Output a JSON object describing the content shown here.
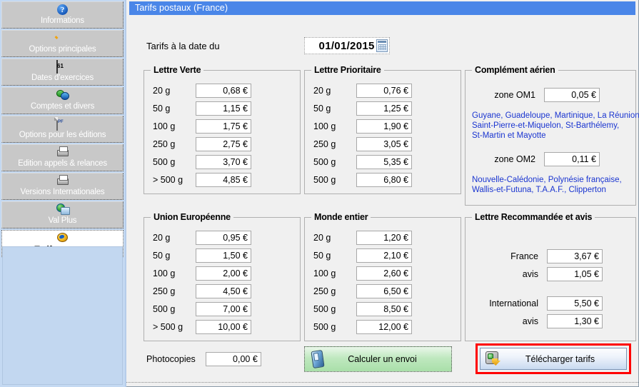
{
  "sidebar": {
    "items": [
      {
        "label": "Informations",
        "icon": "help-icon",
        "active": false
      },
      {
        "label": "Options principales",
        "icon": "gear-icon",
        "active": false
      },
      {
        "label": "Dates d'exercices",
        "icon": "calendar-icon",
        "active": false
      },
      {
        "label": "Comptes et divers",
        "icon": "coins-icon",
        "active": false
      },
      {
        "label": "Options pour les éditions",
        "icon": "pdf-document-icon",
        "active": false
      },
      {
        "label": "Edition appels & relances",
        "icon": "printer-icon",
        "active": false
      },
      {
        "label": "Versions Internationales",
        "icon": "printer-icon",
        "active": false
      },
      {
        "label": "Val Plus",
        "icon": "globe-monitor-icon",
        "active": false
      },
      {
        "label": "Tarifs postaux",
        "icon": "stamp-icon",
        "active": true
      }
    ]
  },
  "titlebar": {
    "title": "Tarifs postaux (France)"
  },
  "date_row": {
    "label": "Tarifs à la date du",
    "value": "01/01/2015",
    "calendar_icon": "calendar-picker-icon"
  },
  "groups": {
    "lettre_verte": {
      "title": "Lettre Verte",
      "rows": [
        {
          "weight": "20 g",
          "price": "0,68 €"
        },
        {
          "weight": "50 g",
          "price": "1,15 €"
        },
        {
          "weight": "100 g",
          "price": "1,75 €"
        },
        {
          "weight": "250 g",
          "price": "2,75 €"
        },
        {
          "weight": "500 g",
          "price": "3,70 €"
        },
        {
          "weight": "> 500 g",
          "price": "4,85 €"
        }
      ]
    },
    "lettre_prioritaire": {
      "title": "Lettre Prioritaire",
      "rows": [
        {
          "weight": "20 g",
          "price": "0,76 €"
        },
        {
          "weight": "50 g",
          "price": "1,25 €"
        },
        {
          "weight": "100 g",
          "price": "1,90 €"
        },
        {
          "weight": "250 g",
          "price": "3,05 €"
        },
        {
          "weight": "500 g",
          "price": "5,35 €"
        },
        {
          "weight": "500 g",
          "price": "6,80 €"
        }
      ]
    },
    "complement_aerien": {
      "title": "Complément aérien",
      "zone1_label": "zone OM1",
      "zone1_value": "0,05 €",
      "zone1_text_line1": "Guyane, Guadeloupe, Martinique, La Réunion,",
      "zone1_text_line2": "Saint-Pierre-et-Miquelon, St-Barthélemy,",
      "zone1_text_line3": "St-Martin et Mayotte",
      "zone2_label": "zone OM2",
      "zone2_value": "0,11 €",
      "zone2_text_line1": "Nouvelle-Calédonie, Polynésie française,",
      "zone2_text_line2": "Wallis-et-Futuna, T.A.A.F., Clipperton"
    },
    "union_europeenne": {
      "title": "Union Européenne",
      "rows": [
        {
          "weight": "20 g",
          "price": "0,95 €"
        },
        {
          "weight": "50 g",
          "price": "1,50 €"
        },
        {
          "weight": "100 g",
          "price": "2,00 €"
        },
        {
          "weight": "250 g",
          "price": "4,50 €"
        },
        {
          "weight": "500 g",
          "price": "7,00 €"
        },
        {
          "weight": "> 500 g",
          "price": "10,00 €"
        }
      ]
    },
    "monde_entier": {
      "title": "Monde entier",
      "rows": [
        {
          "weight": "20 g",
          "price": "1,20 €"
        },
        {
          "weight": "50 g",
          "price": "2,10 €"
        },
        {
          "weight": "100 g",
          "price": "2,60 €"
        },
        {
          "weight": "250 g",
          "price": "6,50 €"
        },
        {
          "weight": "500 g",
          "price": "8,50 €"
        },
        {
          "weight": "500 g",
          "price": "12,00 €"
        }
      ]
    },
    "lettre_recommandee": {
      "title": "Lettre Recommandée et avis",
      "rows": [
        {
          "label": "France",
          "price": "3,67 €"
        },
        {
          "label": "avis",
          "price": "1,05 €"
        },
        {
          "label": "International",
          "price": "5,50 €"
        },
        {
          "label": "avis",
          "price": "1,30 €"
        }
      ]
    }
  },
  "footer": {
    "photocopies_label": "Photocopies",
    "photocopies_value": "0,00 €",
    "calculer_label": "Calculer un envoi",
    "calculer_icon": "mobile-device-icon",
    "telecharger_label": "Télécharger tarifs",
    "telecharger_icon": "download-package-icon"
  },
  "colors": {
    "titlebar": "#4a86e8",
    "sidebar_bg": "#c4d9f2",
    "sidebar_button": "#c8c8c8",
    "blue_text": "#1a35d0",
    "highlight_outline": "#ff0000",
    "window_bg": "#f0f0f0",
    "calc_button": "#a9dfa9"
  }
}
